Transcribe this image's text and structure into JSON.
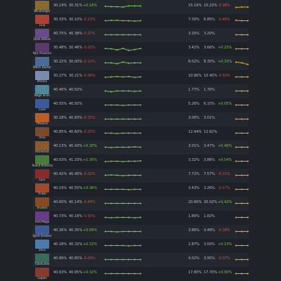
{
  "table": {
    "rows": [
      {
        "hero": "Windranger",
        "col1": "30.14%",
        "col2": "30.31%",
        "delta": "+0.18%",
        "trend": "pos",
        "delta2": "-0.98%",
        "pick1": "15.19%",
        "pick2": "15.22%",
        "spark_g": [
          0.55,
          0.5,
          0.5,
          0.45,
          0.6,
          0.6,
          0.6
        ],
        "spark_o": [
          0.4,
          0.45,
          0.45,
          0.45,
          0.5,
          0.45,
          0.45
        ],
        "color": "#8a6b2e"
      },
      {
        "hero": "Lina",
        "col1": "30.33%",
        "col2": "30.10%",
        "delta": "-0.23%",
        "trend": "neg",
        "delta2": "-0.48%",
        "pick1": "7.30%",
        "pick2": "6.85%",
        "spark_g": [
          0.5,
          0.55,
          0.55,
          0.5,
          0.5,
          0.45,
          0.5
        ],
        "spark_o": [
          0.55,
          0.5,
          0.5,
          0.5,
          0.5,
          0.45,
          0.5
        ],
        "color": "#b04030"
      },
      {
        "hero": "Dark Willow",
        "col1": "40.75%",
        "col2": "40.38%",
        "delta": "-0.37%",
        "trend": "neg",
        "delta2": "",
        "pick1": "3.20%",
        "pick2": "3.20%",
        "spark_g": [
          0.5,
          0.5,
          0.5,
          0.5,
          0.5,
          0.5,
          0.5
        ],
        "spark_o": [
          0.5,
          0.5,
          0.5,
          0.5,
          0.5,
          0.5,
          0.5
        ],
        "color": "#6a4a8a"
      },
      {
        "hero": "Nyx Assassin",
        "col1": "30.48%",
        "col2": "30.46%",
        "delta": "-0.02%",
        "trend": "neg",
        "delta2": "+0.15%",
        "pick1": "3.42%",
        "pick2": "3.66%",
        "spark_g": [
          0.55,
          0.5,
          0.35,
          0.55,
          0.3,
          0.4,
          0.55
        ],
        "spark_o": [
          0.5,
          0.5,
          0.5,
          0.5,
          0.5,
          0.5,
          0.5
        ],
        "color": "#5a3a6a"
      },
      {
        "hero": "Witch Doctor",
        "col1": "30.22%",
        "col2": "30.00%",
        "delta": "-0.22%",
        "trend": "neg",
        "delta2": "+0.33%",
        "pick1": "8.02%",
        "pick2": "8.35%",
        "spark_g": [
          0.5,
          0.5,
          0.4,
          0.6,
          0.45,
          0.5,
          0.5
        ],
        "spark_o": [
          0.6,
          0.5,
          0.3,
          0.5,
          0.35,
          0.35,
          0.45
        ],
        "color": "#4a6a9a"
      },
      {
        "hero": "Mirana",
        "col1": "30.27%",
        "col2": "30.21%",
        "delta": "-0.06%",
        "trend": "neg",
        "delta2": "-0.50%",
        "pick1": "10.90%",
        "pick2": "10.40%",
        "spark_g": [
          0.45,
          0.5,
          0.55,
          0.5,
          0.55,
          0.45,
          0.5
        ],
        "spark_o": [
          0.5,
          0.5,
          0.5,
          0.5,
          0.5,
          0.5,
          0.5
        ],
        "color": "#7a8ab0"
      },
      {
        "hero": "Naga Siren",
        "col1": "40.40%",
        "col2": "40.02%",
        "delta": "",
        "trend": "neg",
        "delta2": "",
        "pick1": "1.77%",
        "pick2": "1.76%",
        "spark_g": [
          0.5,
          0.4,
          0.5,
          0.5,
          0.5,
          0.45,
          0.5
        ],
        "spark_o": [
          0.5,
          0.5,
          0.5,
          0.5,
          0.5,
          0.5,
          0.5
        ],
        "color": "#4a8a9a"
      },
      {
        "hero": "Luna",
        "col1": "40.55%",
        "col2": "40.50%",
        "delta": "",
        "trend": "neg",
        "delta2": "+0.05%",
        "pick1": "5.26%",
        "pick2": "6.15%",
        "spark_g": [
          0.5,
          0.5,
          0.5,
          0.45,
          0.5,
          0.5,
          0.5
        ],
        "spark_o": [
          0.5,
          0.5,
          0.5,
          0.5,
          0.5,
          0.5,
          0.5
        ],
        "color": "#3a5aa0"
      },
      {
        "hero": "Phoenix",
        "col1": "30.18%",
        "col2": "40.83%",
        "delta": "-0.35%",
        "trend": "neg",
        "delta2": "",
        "pick1": "3.06%",
        "pick2": "3.01%",
        "spark_g": [
          0.5,
          0.5,
          0.5,
          0.5,
          0.5,
          0.5,
          0.5
        ],
        "spark_o": [
          0.5,
          0.5,
          0.5,
          0.5,
          0.5,
          0.5,
          0.5
        ],
        "color": "#c05a20"
      },
      {
        "hero": "Ursa",
        "col1": "40.85%",
        "col2": "40.60%",
        "delta": "-0.25%",
        "trend": "neg",
        "delta2": "",
        "pick1": "12.94%",
        "pick2": "12.62%",
        "spark_g": [
          0.5,
          0.5,
          0.45,
          0.5,
          0.5,
          0.5,
          0.5
        ],
        "spark_o": [
          0.5,
          0.5,
          0.5,
          0.5,
          0.5,
          0.5,
          0.5
        ],
        "color": "#7a4a2a"
      },
      {
        "hero": "Alchemist",
        "col1": "40.13%",
        "col2": "40.43%",
        "delta": "+0.30%",
        "trend": "pos",
        "delta2": "+0.46%",
        "pick1": "3.01%",
        "pick2": "3.47%",
        "spark_g": [
          0.5,
          0.45,
          0.5,
          0.5,
          0.5,
          0.55,
          0.5
        ],
        "spark_o": [
          0.5,
          0.5,
          0.5,
          0.5,
          0.5,
          0.5,
          0.5
        ],
        "color": "#8a5a2a"
      },
      {
        "hero": "Treant Protector",
        "col1": "40.03%",
        "col2": "41.33%",
        "delta": "+1.30%",
        "trend": "pos",
        "delta2": "+0.54%",
        "pick1": "3.32%",
        "pick2": "3.86%",
        "spark_g": [
          0.45,
          0.5,
          0.5,
          0.45,
          0.5,
          0.5,
          0.55
        ],
        "spark_o": [
          0.5,
          0.5,
          0.5,
          0.5,
          0.5,
          0.5,
          0.5
        ],
        "color": "#4a7a3a"
      },
      {
        "hero": "Lion",
        "col1": "40.42%",
        "col2": "40.40%",
        "delta": "-0.02%",
        "trend": "neg",
        "delta2": "-0.15%",
        "pick1": "7.72%",
        "pick2": "7.57%",
        "spark_g": [
          0.5,
          0.55,
          0.5,
          0.45,
          0.5,
          0.5,
          0.5
        ],
        "spark_o": [
          0.5,
          0.5,
          0.5,
          0.5,
          0.5,
          0.5,
          0.5
        ],
        "color": "#8a2a2a"
      },
      {
        "hero": "Tinker",
        "col1": "40.19%",
        "col2": "40.55%",
        "delta": "+0.36%",
        "trend": "pos",
        "delta2": "-0.17%",
        "pick1": "3.43%",
        "pick2": "3.26%",
        "spark_g": [
          0.5,
          0.5,
          0.5,
          0.5,
          0.45,
          0.5,
          0.5
        ],
        "spark_o": [
          0.5,
          0.5,
          0.5,
          0.5,
          0.5,
          0.5,
          0.5
        ],
        "color": "#a04a2a"
      },
      {
        "hero": "Invoker",
        "col1": "40.60%",
        "col2": "40.14%",
        "delta": "-0.46%",
        "trend": "neg",
        "delta2": "+0.42%",
        "pick1": "20.60%",
        "pick2": "20.02%",
        "spark_g": [
          0.5,
          0.5,
          0.5,
          0.5,
          0.5,
          0.5,
          0.5
        ],
        "spark_o": [
          0.5,
          0.5,
          0.5,
          0.5,
          0.5,
          0.5,
          0.5
        ],
        "color": "#8a4a1a"
      },
      {
        "hero": "Anti-Mage",
        "col1": "40.73%",
        "col2": "40.18%",
        "delta": "-0.55%",
        "trend": "neg",
        "delta2": "",
        "pick1": "1.80%",
        "pick2": "1.82%",
        "spark_g": [
          0.5,
          0.45,
          0.5,
          0.5,
          0.5,
          0.45,
          0.5
        ],
        "spark_o": [
          0.5,
          0.5,
          0.5,
          0.5,
          0.5,
          0.5,
          0.5
        ],
        "color": "#6a3a8a"
      },
      {
        "hero": "Spirit Breaker",
        "col1": "40.26%",
        "col2": "40.35%",
        "delta": "+0.09%",
        "trend": "pos",
        "delta2": "-0.38%",
        "pick1": "3.86%",
        "pick2": "3.48%",
        "spark_g": [
          0.5,
          0.5,
          0.45,
          0.5,
          0.5,
          0.5,
          0.5
        ],
        "spark_o": [
          0.5,
          0.5,
          0.5,
          0.5,
          0.5,
          0.55,
          0.5
        ],
        "color": "#3a5a9a"
      },
      {
        "hero": "Zeus",
        "col1": "40.18%",
        "col2": "40.32%",
        "delta": "+0.22%",
        "trend": "pos",
        "delta2": "+0.13%",
        "pick1": "2.87%",
        "pick2": "3.00%",
        "spark_g": [
          0.5,
          0.5,
          0.5,
          0.5,
          0.45,
          0.5,
          0.5
        ],
        "spark_o": [
          0.5,
          0.5,
          0.5,
          0.5,
          0.5,
          0.5,
          0.5
        ],
        "color": "#4a7ab0"
      },
      {
        "hero": "Tidehunter",
        "col1": "40.89%",
        "col2": "40.85%",
        "delta": "-0.04%",
        "trend": "neg",
        "delta2": "-0.07%",
        "pick1": "4.02%",
        "pick2": "3.95%",
        "spark_g": [
          0.5,
          0.5,
          0.5,
          0.5,
          0.5,
          0.5,
          0.5
        ],
        "spark_o": [
          0.5,
          0.5,
          0.5,
          0.5,
          0.5,
          0.5,
          0.5
        ],
        "color": "#3a6a5a"
      },
      {
        "hero": "Legion",
        "col1": "40.63%",
        "col2": "40.95%",
        "delta": "+0.32%",
        "trend": "pos",
        "delta2": "+0.90%",
        "pick1": "17.80%",
        "pick2": "17.70%",
        "spark_g": [
          0.5,
          0.5,
          0.5,
          0.5,
          0.5,
          0.5,
          0.5
        ],
        "spark_o": [
          0.5,
          0.5,
          0.5,
          0.5,
          0.5,
          0.5,
          0.5
        ],
        "color": "#8a3a2a"
      }
    ]
  },
  "colors": {
    "positive": "#78c24a",
    "negative": "#d05040",
    "spark_green": "#6fbf3f",
    "spark_orange": "#e0a020",
    "grid": "#3a3f47"
  }
}
